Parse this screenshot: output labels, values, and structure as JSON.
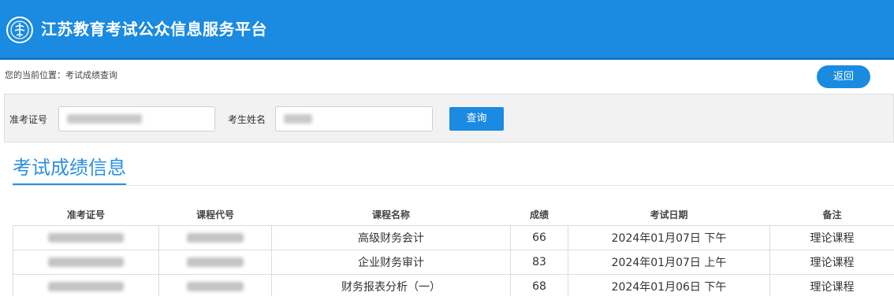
{
  "header": {
    "title": "江苏教育考试公众信息服务平台",
    "logo_icon": "education-emblem-icon"
  },
  "breadcrumb": "您的当前位置：考试成绩查询",
  "back_label": "返回",
  "search": {
    "ticket_label": "准考证号",
    "name_label": "考生姓名",
    "query_label": "查询"
  },
  "section_title": "考试成绩信息",
  "table": {
    "headers": [
      "准考证号",
      "课程代号",
      "课程名称",
      "成绩",
      "考试日期",
      "备注"
    ],
    "rows": [
      {
        "course_name": "高级财务会计",
        "score": "66",
        "date": "2024年01月07日 下午",
        "note": "理论课程"
      },
      {
        "course_name": "企业财务审计",
        "score": "83",
        "date": "2024年01月07日 上午",
        "note": "理论课程"
      },
      {
        "course_name": "财务报表分析（一）",
        "score": "68",
        "date": "2024年01月06日 下午",
        "note": "理论课程"
      }
    ]
  },
  "colors": {
    "brand_blue": "#1a8be0",
    "title_blue": "#2b8fe0"
  }
}
